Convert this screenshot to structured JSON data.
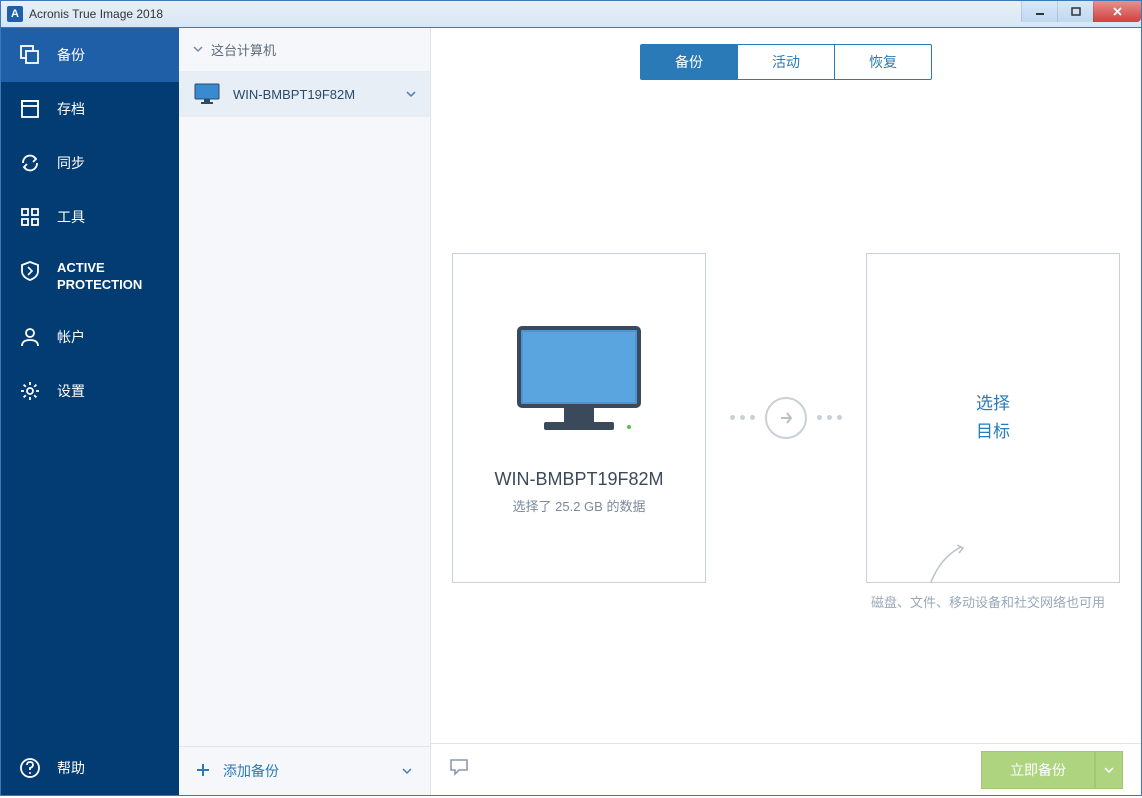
{
  "titlebar": {
    "icon_letter": "A",
    "title": "Acronis True Image 2018"
  },
  "sidebar": {
    "items": [
      {
        "label": "备份"
      },
      {
        "label": "存档"
      },
      {
        "label": "同步"
      },
      {
        "label": "工具"
      },
      {
        "label": "ACTIVE PROTECTION"
      },
      {
        "label": "帐户"
      },
      {
        "label": "设置"
      }
    ],
    "help_label": "帮助"
  },
  "list": {
    "header": "这台计算机",
    "item_label": "WIN-BMBPT19F82M",
    "add_label": "添加备份"
  },
  "tabs": {
    "backup": "备份",
    "activity": "活动",
    "recovery": "恢复"
  },
  "source": {
    "title": "WIN-BMBPT19F82M",
    "subtitle": "选择了 25.2 GB 的数据"
  },
  "dest": {
    "line1": "选择",
    "line2": "目标"
  },
  "hint": "磁盘、文件、移动设备和社交网络也可用",
  "footer": {
    "backup_now": "立即备份"
  }
}
